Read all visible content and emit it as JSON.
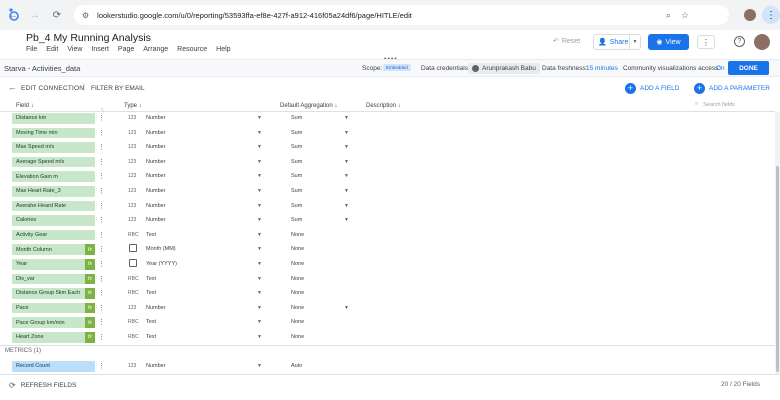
{
  "browser": {
    "url": "lookerstudio.google.com/u/0/reporting/53593ffa-ef8e-427f-a912-416f05a24df6/page/HITLE/edit"
  },
  "header": {
    "title": "Pb_4 My Running Analysis",
    "menu": [
      "File",
      "Edit",
      "View",
      "Insert",
      "Page",
      "Arrange",
      "Resource",
      "Help"
    ],
    "reset_label": "Reset",
    "share_label": "Share",
    "view_label": "View"
  },
  "datasource": {
    "name": "Starva - Activities_data",
    "scope_label": "Scope:",
    "scope_value": "Embedded",
    "credentials_label": "Data credentials:",
    "credentials_user": "Arunprakash Babu",
    "freshness_label": "Data freshness:",
    "freshness_value": "15 minutes",
    "community_label": "Community visualizations access:",
    "community_value": "On",
    "done_label": "DONE"
  },
  "toolbar": {
    "edit_connection": "EDIT CONNECTION",
    "separator": "|",
    "filter_by_email": "FILTER BY EMAIL",
    "add_field": "ADD A FIELD",
    "add_parameter": "ADD A PARAMETER"
  },
  "columns": {
    "field": "Field",
    "type": "Type",
    "aggregation": "Default Aggregation",
    "description": "Description",
    "search_placeholder": "Search fields"
  },
  "dimension_rows": [
    {
      "name": "Distance km",
      "type_icon": "123",
      "type": "Number",
      "agg": "Sum",
      "fx": false,
      "agg_dd": true
    },
    {
      "name": "Moving Time min",
      "type_icon": "123",
      "type": "Number",
      "agg": "Sum",
      "fx": false,
      "agg_dd": true
    },
    {
      "name": "Max Speed m/s",
      "type_icon": "123",
      "type": "Number",
      "agg": "Sum",
      "fx": false,
      "agg_dd": true
    },
    {
      "name": "Average Speed m/s",
      "type_icon": "123",
      "type": "Number",
      "agg": "Sum",
      "fx": false,
      "agg_dd": true
    },
    {
      "name": "Elevation Gain m",
      "type_icon": "123",
      "type": "Number",
      "agg": "Sum",
      "fx": false,
      "agg_dd": true
    },
    {
      "name": "Max Heart Rate_3",
      "type_icon": "123",
      "type": "Number",
      "agg": "Sum",
      "fx": false,
      "agg_dd": true
    },
    {
      "name": "Averahe Heard Rate",
      "type_icon": "123",
      "type": "Number",
      "agg": "Sum",
      "fx": false,
      "agg_dd": true
    },
    {
      "name": "Calories",
      "type_icon": "123",
      "type": "Number",
      "agg": "Sum",
      "fx": false,
      "agg_dd": true
    },
    {
      "name": "Activity Gear",
      "type_icon": "RBC",
      "type": "Text",
      "agg": "None",
      "fx": false,
      "agg_dd": false
    },
    {
      "name": "Month Column",
      "type_icon": "cal",
      "type": "Month (MM)",
      "agg": "None",
      "fx": true,
      "agg_dd": false
    },
    {
      "name": "Year",
      "type_icon": "cal",
      "type": "Year (YYYY)",
      "agg": "None",
      "fx": true,
      "agg_dd": false
    },
    {
      "name": "Dis_var",
      "type_icon": "RBC",
      "type": "Text",
      "agg": "None",
      "fx": true,
      "agg_dd": false
    },
    {
      "name": "Distance Group 5km Each",
      "type_icon": "RBC",
      "type": "Text",
      "agg": "None",
      "fx": true,
      "agg_dd": false
    },
    {
      "name": "Pace",
      "type_icon": "123",
      "type": "Number",
      "agg": "None",
      "fx": true,
      "agg_dd": true
    },
    {
      "name": "Pace Group km/min",
      "type_icon": "RBC",
      "type": "Text",
      "agg": "None",
      "fx": true,
      "agg_dd": false
    },
    {
      "name": "Heart Zone",
      "type_icon": "RBC",
      "type": "Text",
      "agg": "None",
      "fx": true,
      "agg_dd": false
    }
  ],
  "metrics_header": "METRICS (1)",
  "metric_rows": [
    {
      "name": "Record Count",
      "type_icon": "123",
      "type": "Number",
      "agg": "Auto",
      "fx": false,
      "agg_dd": false
    }
  ],
  "footer": {
    "refresh_label": "REFRESH FIELDS",
    "count": "20 / 20 Fields"
  },
  "colors": {
    "accent": "#1a73e8",
    "dimension_chip": "#c8e6c9",
    "metric_chip": "#bbdefb",
    "fx_badge": "#7cb342"
  }
}
